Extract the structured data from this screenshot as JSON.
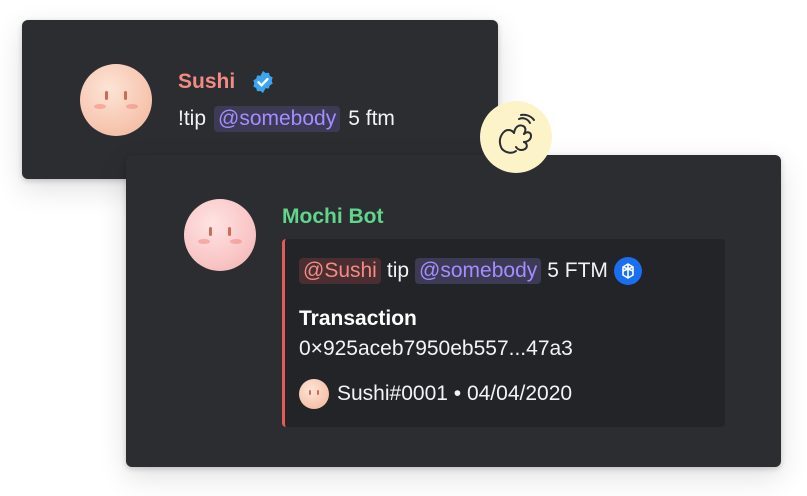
{
  "user_message": {
    "author": "Sushi",
    "author_color": "#f28b84",
    "verified_icon": "verified-badge-icon",
    "command": "!tip",
    "mention": "@somebody",
    "amount": "5 ftm"
  },
  "bot_message": {
    "author": "Mochi Bot",
    "author_color": "#5fd78b",
    "embed": {
      "accent_color": "#e25b5b",
      "mention_user": "@Sushi",
      "verb": "tip",
      "mention_target": "@somebody",
      "amount": "5 FTM",
      "token_icon": "fantom-token-icon",
      "field_title": "Transaction",
      "field_value": "0×925aceb7950eb557...47a3",
      "footer": "Sushi#0001 • 04/04/2020"
    }
  },
  "reaction_icon": "pinky-promise-hand-icon"
}
